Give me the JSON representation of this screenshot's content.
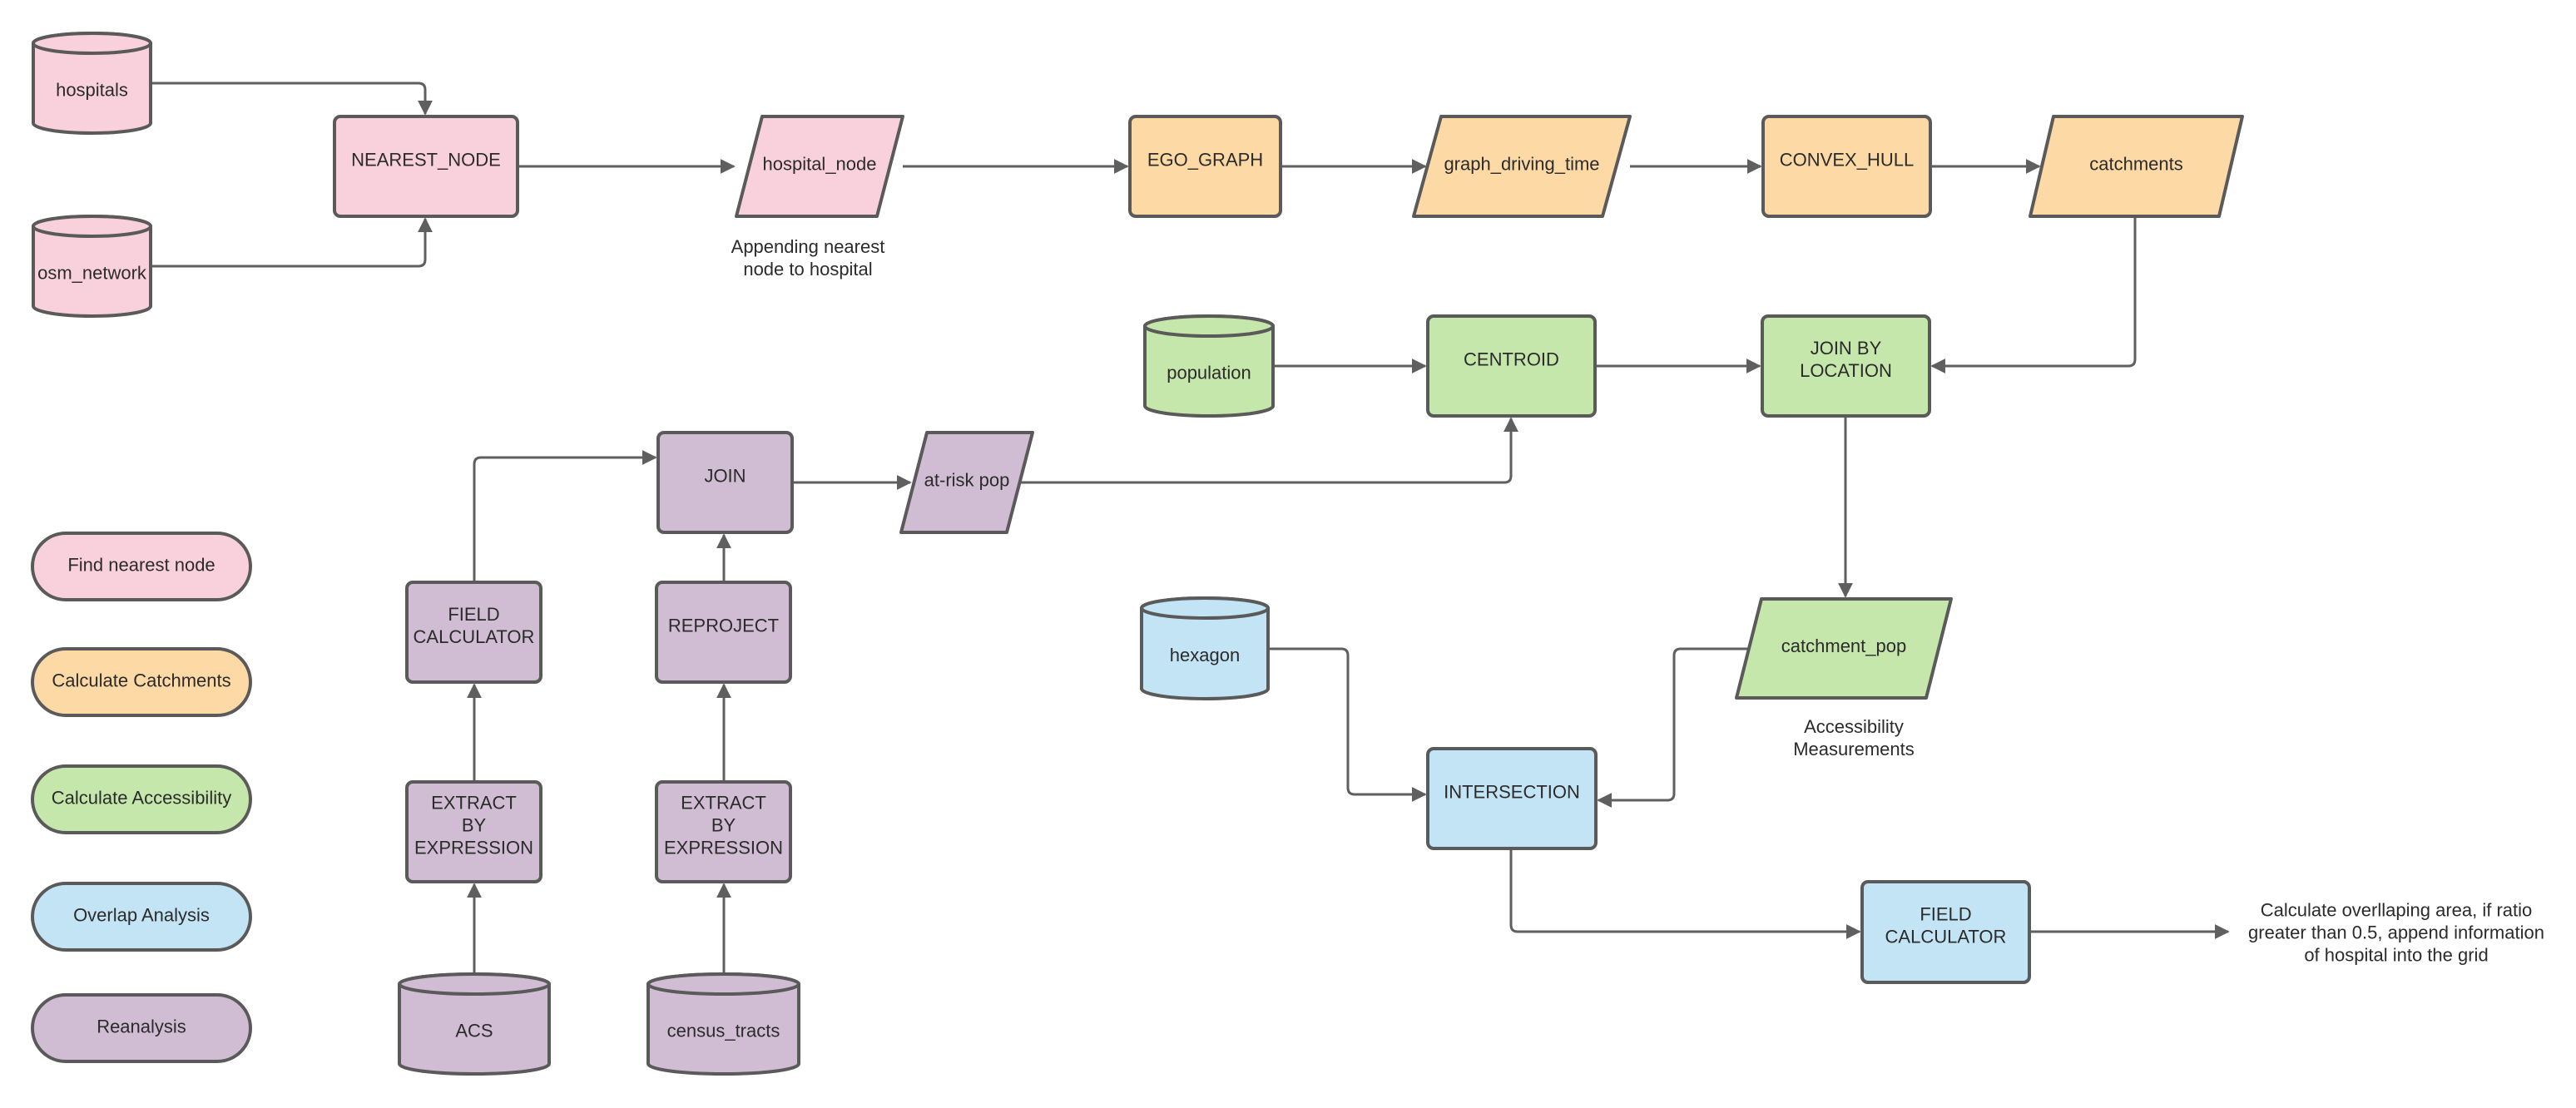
{
  "diagram": {
    "type": "flowchart",
    "colors": {
      "find_nearest_node": "#f9d1dc",
      "calculate_catchments": "#fdd9a6",
      "calculate_accessibility": "#c6e7ab",
      "overlap_analysis": "#c3e4f5",
      "reanalysis": "#d1bdd3",
      "stroke": "#5a5a5a"
    },
    "nodes": {
      "hospitals": {
        "label": [
          "hospitals"
        ],
        "shape": "database",
        "group": "pink"
      },
      "osm_network": {
        "label": [
          "osm_network"
        ],
        "shape": "database",
        "group": "pink"
      },
      "nearest_node": {
        "label": [
          "NEAREST_NODE"
        ],
        "shape": "process",
        "group": "pink"
      },
      "hospital_node": {
        "label": [
          "hospital_node"
        ],
        "shape": "data",
        "group": "pink"
      },
      "ego_graph": {
        "label": [
          "EGO_GRAPH"
        ],
        "shape": "process",
        "group": "orange"
      },
      "graph_driving_time": {
        "label": [
          "graph_driving_time"
        ],
        "shape": "data",
        "group": "orange"
      },
      "convex_hull": {
        "label": [
          "CONVEX_HULL"
        ],
        "shape": "process",
        "group": "orange"
      },
      "catchments": {
        "label": [
          "catchments"
        ],
        "shape": "data",
        "group": "orange"
      },
      "population": {
        "label": [
          "population"
        ],
        "shape": "database",
        "group": "green"
      },
      "centroid": {
        "label": [
          "CENTROID"
        ],
        "shape": "process",
        "group": "green"
      },
      "join_by_location": {
        "label": [
          "JOIN BY",
          "LOCATION"
        ],
        "shape": "process",
        "group": "green"
      },
      "catchment_pop": {
        "label": [
          "catchment_pop"
        ],
        "shape": "data",
        "group": "green"
      },
      "hexagon": {
        "label": [
          "hexagon"
        ],
        "shape": "database",
        "group": "blue"
      },
      "intersection": {
        "label": [
          "INTERSECTION"
        ],
        "shape": "process",
        "group": "blue"
      },
      "field_calculator_blue": {
        "label": [
          "FIELD",
          "CALCULATOR"
        ],
        "shape": "process",
        "group": "blue"
      },
      "join": {
        "label": [
          "JOIN"
        ],
        "shape": "process",
        "group": "purple"
      },
      "at_risk_pop": {
        "label": [
          "at-risk pop"
        ],
        "shape": "data",
        "group": "purple"
      },
      "field_calculator_purple": {
        "label": [
          "FIELD",
          "CALCULATOR"
        ],
        "shape": "process",
        "group": "purple"
      },
      "reproject": {
        "label": [
          "REPROJECT"
        ],
        "shape": "process",
        "group": "purple"
      },
      "extract_acs": {
        "label": [
          "EXTRACT",
          "BY",
          "EXPRESSION"
        ],
        "shape": "process",
        "group": "purple"
      },
      "extract_census": {
        "label": [
          "EXTRACT",
          "BY",
          "EXPRESSION"
        ],
        "shape": "process",
        "group": "purple"
      },
      "acs": {
        "label": [
          "ACS"
        ],
        "shape": "database",
        "group": "purple"
      },
      "census_tracts": {
        "label": [
          "census_tracts"
        ],
        "shape": "database",
        "group": "purple"
      }
    },
    "edges": [
      {
        "from": "hospitals",
        "to": "nearest_node"
      },
      {
        "from": "osm_network",
        "to": "nearest_node"
      },
      {
        "from": "nearest_node",
        "to": "hospital_node"
      },
      {
        "from": "hospital_node",
        "to": "ego_graph"
      },
      {
        "from": "ego_graph",
        "to": "graph_driving_time"
      },
      {
        "from": "graph_driving_time",
        "to": "convex_hull"
      },
      {
        "from": "convex_hull",
        "to": "catchments"
      },
      {
        "from": "catchments",
        "to": "join_by_location"
      },
      {
        "from": "population",
        "to": "centroid"
      },
      {
        "from": "centroid",
        "to": "join_by_location"
      },
      {
        "from": "join_by_location",
        "to": "catchment_pop"
      },
      {
        "from": "acs",
        "to": "extract_acs"
      },
      {
        "from": "extract_acs",
        "to": "field_calculator_purple"
      },
      {
        "from": "field_calculator_purple",
        "to": "join"
      },
      {
        "from": "census_tracts",
        "to": "extract_census"
      },
      {
        "from": "extract_census",
        "to": "reproject"
      },
      {
        "from": "reproject",
        "to": "join"
      },
      {
        "from": "join",
        "to": "at_risk_pop"
      },
      {
        "from": "at_risk_pop",
        "to": "centroid"
      },
      {
        "from": "hexagon",
        "to": "intersection"
      },
      {
        "from": "catchment_pop",
        "to": "intersection"
      },
      {
        "from": "intersection",
        "to": "field_calculator_blue"
      },
      {
        "from": "field_calculator_blue",
        "to": "note_overlap"
      }
    ],
    "notes": {
      "hospital_node_note": [
        "Appending nearest",
        "node to hospital"
      ],
      "accessibility_note": [
        "Accessibility",
        "Measurements"
      ],
      "note_overlap": [
        "Calculate overllaping area, if ratio",
        "greater than 0.5, append information",
        "of hospital into the grid"
      ]
    },
    "legend": [
      {
        "label": "Find nearest node",
        "group": "pink"
      },
      {
        "label": "Calculate Catchments",
        "group": "orange"
      },
      {
        "label": "Calculate Accessibility",
        "group": "green"
      },
      {
        "label": "Overlap Analysis",
        "group": "blue"
      },
      {
        "label": "Reanalysis",
        "group": "purple"
      }
    ]
  }
}
